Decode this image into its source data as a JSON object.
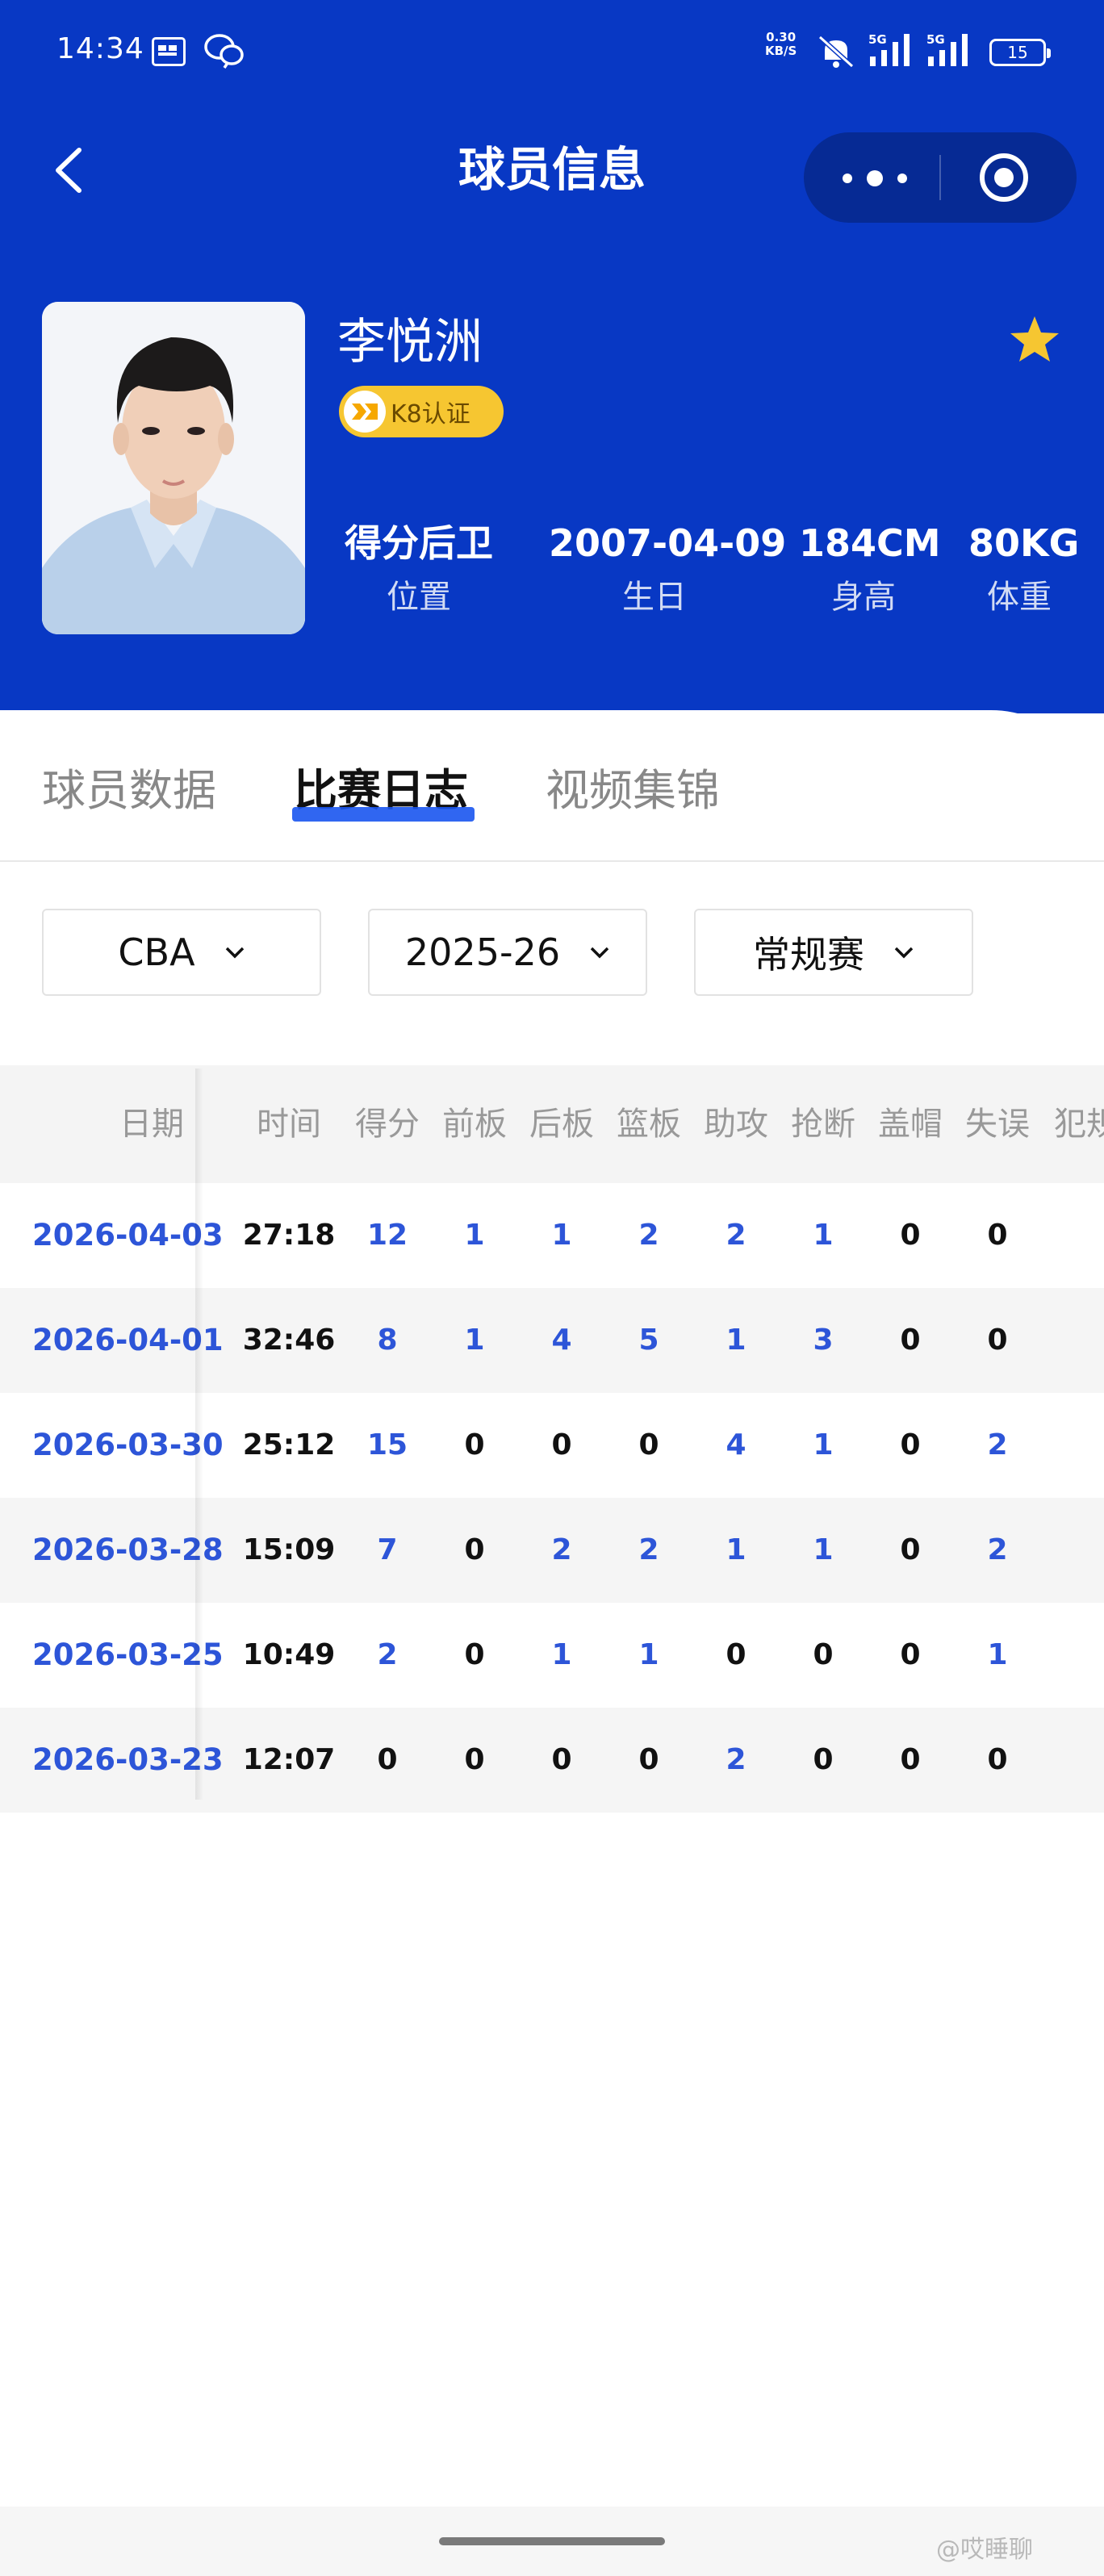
{
  "status_bar": {
    "time": "14:34",
    "net_speed": "0.30",
    "net_unit": "KB/S",
    "signal_1": "5G",
    "signal_2": "5G",
    "battery": "15"
  },
  "nav": {
    "title": "球员信息"
  },
  "player": {
    "name": "李悦洲",
    "badge": "K8认证",
    "favorited": true,
    "stats": [
      {
        "value": "得分后卫",
        "label": "位置"
      },
      {
        "value": "2007-04-09",
        "label": "生日"
      },
      {
        "value": "184CM",
        "label": "身高"
      },
      {
        "value": "80KG",
        "label": "体重"
      }
    ]
  },
  "tabs": [
    {
      "label": "球员数据",
      "active": false
    },
    {
      "label": "比赛日志",
      "active": true
    },
    {
      "label": "视频集锦",
      "active": false
    }
  ],
  "filters": [
    {
      "value": "CBA"
    },
    {
      "value": "2025-26"
    },
    {
      "value": "常规赛"
    }
  ],
  "table": {
    "columns": [
      "日期",
      "时间",
      "得分",
      "前板",
      "后板",
      "篮板",
      "助攻",
      "抢断",
      "盖帽",
      "失误",
      "犯规"
    ],
    "rows": [
      [
        "2026-04-03",
        "27:18",
        "12",
        "1",
        "1",
        "2",
        "2",
        "1",
        "0",
        "0"
      ],
      [
        "2026-04-01",
        "32:46",
        "8",
        "1",
        "4",
        "5",
        "1",
        "3",
        "0",
        "0"
      ],
      [
        "2026-03-30",
        "25:12",
        "15",
        "0",
        "0",
        "0",
        "4",
        "1",
        "0",
        "2"
      ],
      [
        "2026-03-28",
        "15:09",
        "7",
        "0",
        "2",
        "2",
        "1",
        "1",
        "0",
        "2"
      ],
      [
        "2026-03-25",
        "10:49",
        "2",
        "0",
        "1",
        "1",
        "0",
        "0",
        "0",
        "1"
      ],
      [
        "2026-03-23",
        "12:07",
        "0",
        "0",
        "0",
        "0",
        "2",
        "0",
        "0",
        "0"
      ]
    ]
  },
  "watermark": "@哎睡聊",
  "colors": {
    "header_blue": "#0838c4",
    "link_blue": "#2d55d8",
    "badge_gold": "#f6c631",
    "star_gold": "#f6c631"
  }
}
